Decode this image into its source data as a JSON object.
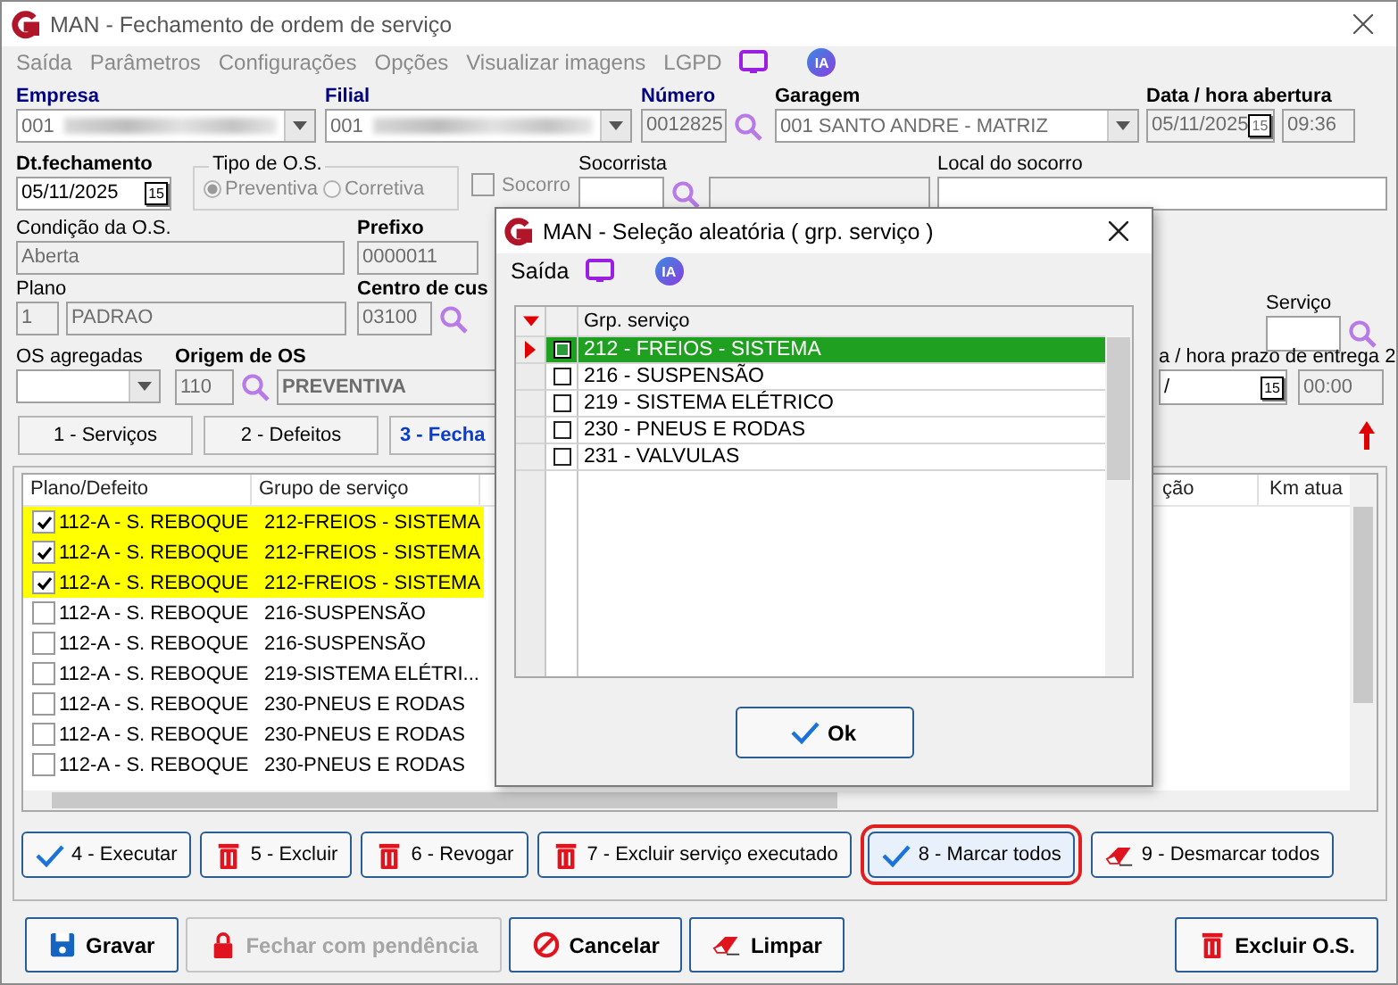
{
  "window": {
    "title": "MAN - Fechamento de ordem de serviço",
    "menu": [
      {
        "label": "Saída",
        "disabled": true
      },
      {
        "label": "Parâmetros",
        "disabled": true
      },
      {
        "label": "Configurações",
        "disabled": true
      },
      {
        "label": "Opções",
        "disabled": true
      },
      {
        "label": "Visualizar imagens",
        "disabled": true
      },
      {
        "label": "LGPD",
        "disabled": true
      }
    ],
    "ai_badge": "IA"
  },
  "form": {
    "empresa": {
      "label": "Empresa",
      "value": "001"
    },
    "filial": {
      "label": "Filial",
      "value": "001"
    },
    "numero": {
      "label": "Número",
      "value": "0012825"
    },
    "garagem": {
      "label": "Garagem",
      "value": "001 SANTO ANDRE - MATRIZ"
    },
    "abertura": {
      "label": "Data / hora abertura",
      "date": "05/11/2025",
      "calendar": "15",
      "time": "09:36"
    },
    "dt_fechamento": {
      "label": "Dt.fechamento",
      "date": "05/11/2025",
      "calendar": "15"
    },
    "tipo_os": {
      "label": "Tipo de O.S.",
      "options": [
        {
          "label": "Preventiva",
          "selected": true
        },
        {
          "label": "Corretiva",
          "selected": false
        }
      ]
    },
    "socorro": {
      "label": "Socorro",
      "checked": false
    },
    "socorrista": {
      "label": "Socorrista"
    },
    "local_socorro": {
      "label": "Local do socorro"
    },
    "condicao": {
      "label": "Condição da O.S.",
      "value": "Aberta"
    },
    "prefixo": {
      "label": "Prefixo",
      "value": "0000011"
    },
    "plano": {
      "label": "Plano",
      "code": "1",
      "name": "PADRAO"
    },
    "centro_custo": {
      "label": "Centro de cus",
      "value": "03100"
    },
    "servico": {
      "label": "Serviço"
    },
    "os_agregadas": {
      "label": "OS agregadas"
    },
    "origem": {
      "label": "Origem de OS",
      "code": "110",
      "name": "PREVENTIVA"
    },
    "prazo_entrega": {
      "label": "a / hora prazo de entrega 2",
      "date": "/",
      "calendar": "15",
      "time": "00:00"
    }
  },
  "tabs": [
    {
      "label": "1 - Serviços",
      "selected": false
    },
    {
      "label": "2 - Defeitos",
      "selected": false
    },
    {
      "label": "3 - Fecha",
      "selected": true
    }
  ],
  "table": {
    "columns": [
      "Plano/Defeito",
      "Grupo de serviço",
      "ção",
      "Km atua"
    ],
    "rows": [
      {
        "plan": "112-A - S. REBOQUE",
        "group": "212-FREIOS - SISTEMA",
        "checked": true
      },
      {
        "plan": "112-A - S. REBOQUE",
        "group": "212-FREIOS - SISTEMA",
        "checked": true
      },
      {
        "plan": "112-A - S. REBOQUE",
        "group": "212-FREIOS - SISTEMA",
        "checked": true
      },
      {
        "plan": "112-A - S. REBOQUE",
        "group": "216-SUSPENSÃO",
        "checked": false
      },
      {
        "plan": "112-A - S. REBOQUE",
        "group": "216-SUSPENSÃO",
        "checked": false
      },
      {
        "plan": "112-A - S. REBOQUE",
        "group": "219-SISTEMA ELÉTRI...",
        "checked": false
      },
      {
        "plan": "112-A - S. REBOQUE",
        "group": "230-PNEUS E RODAS",
        "checked": false
      },
      {
        "plan": "112-A - S. REBOQUE",
        "group": "230-PNEUS E RODAS",
        "checked": false
      },
      {
        "plan": "112-A - S. REBOQUE",
        "group": "230-PNEUS E RODAS",
        "checked": false
      }
    ]
  },
  "actions": [
    {
      "label": "4 - Executar",
      "kind": "check",
      "highlighted": false
    },
    {
      "label": "5 - Excluir",
      "kind": "trash",
      "highlighted": false
    },
    {
      "label": "6 - Revogar",
      "kind": "trash",
      "highlighted": false
    },
    {
      "label": "7 - Excluir serviço executado",
      "kind": "trash",
      "highlighted": false
    },
    {
      "label": "8 - Marcar todos",
      "kind": "check",
      "highlighted": true
    },
    {
      "label": "9 - Desmarcar todos",
      "kind": "eraser",
      "highlighted": false
    }
  ],
  "footer_buttons": [
    {
      "label": "Gravar",
      "kind": "save",
      "disabled": false
    },
    {
      "label": "Fechar com pendência",
      "kind": "lock",
      "disabled": true
    },
    {
      "label": "Cancelar",
      "kind": "cancel",
      "disabled": false
    },
    {
      "label": "Limpar",
      "kind": "eraser",
      "disabled": false
    },
    {
      "label": "Excluir O.S.",
      "kind": "trash",
      "disabled": false
    }
  ],
  "dialog": {
    "title": "MAN - Seleção aleatória ( grp. serviço )",
    "menu": [
      {
        "label": "Saída",
        "disabled": false
      }
    ],
    "ai_badge": "IA",
    "column": "Grp. serviço",
    "rows": [
      {
        "label": "212 - FREIOS - SISTEMA",
        "checked": true,
        "selected": true
      },
      {
        "label": "216 - SUSPENSÃO",
        "checked": false,
        "selected": false
      },
      {
        "label": "219 - SISTEMA ELÉTRICO",
        "checked": false,
        "selected": false
      },
      {
        "label": "230 - PNEUS E RODAS",
        "checked": false,
        "selected": false
      },
      {
        "label": "231 - VALVULAS",
        "checked": false,
        "selected": false
      }
    ],
    "ok": "Ok"
  }
}
